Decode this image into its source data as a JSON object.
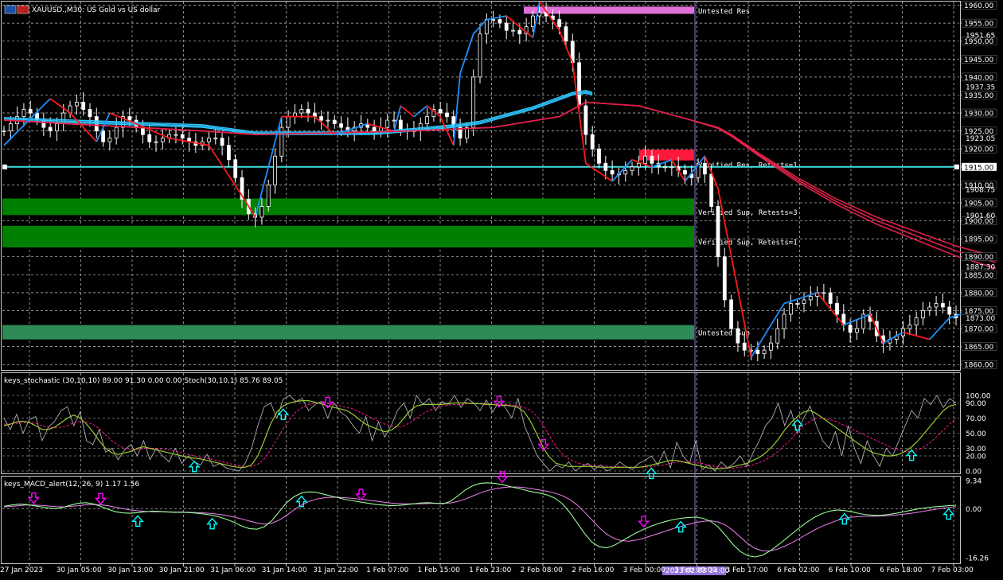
{
  "window": {
    "title": "XAUUSD.,M30:  US Gold vs US dollar"
  },
  "colors": {
    "background": "#000000",
    "grid": "#c8c8c8",
    "axis": "#c8c8c8",
    "bull": "#ffffff",
    "bear": "#ffffff",
    "zigzag_up": "#1e90ff",
    "zigzag_down": "#ff1a1a",
    "ma_fast": "#2ec8ff",
    "ma_slow": "#e0204a",
    "verified_sup": "#008000",
    "untested_sup": "#2e8b57",
    "verified_res": "#ff1a3c",
    "untested_res": "#e070d8",
    "hline": "#40e0e0",
    "stoch_main": "#9acd32",
    "stoch_signal": "#ff1493",
    "stoch_raw": "#c0c0c0",
    "macd_main": "#98fb98",
    "macd_signal": "#ee82ee",
    "arrow_up": "#00ffff",
    "arrow_down": "#ff00ff",
    "label_text": "#ffffff",
    "date_marker": "#9370db"
  },
  "chart_data": [
    {
      "type": "line",
      "title": "XAUUSD.,M30:  US Gold vs US dollar",
      "price_axis": {
        "ticks": [
          "1960.00",
          "1955.00",
          "1950.00",
          "1945.00",
          "1940.00",
          "1935.00",
          "1930.00",
          "1925.00",
          "1920.00",
          "1915.00",
          "1910.00",
          "1905.00",
          "1900.00",
          "1895.00",
          "1890.00",
          "1885.00",
          "1880.00",
          "1875.00",
          "1870.00",
          "1865.00",
          "1860.00"
        ],
        "extra_labels": [
          "1951.65",
          "1937.35",
          "1923.05",
          "1908.75",
          "1901.60",
          "1887.30",
          "1873.00"
        ],
        "highlight_label": "1915.00",
        "ylim": [
          1858.5,
          1961
        ]
      },
      "time_axis": {
        "labels": [
          "27 Jan 2023",
          "30 Jan 05:00",
          "30 Jan 13:00",
          "30 Jan 21:00",
          "31 Jan 06:00",
          "31 Jan 14:00",
          "31 Jan 22:00",
          "1 Feb 07:00",
          "1 Feb 15:00",
          "1 Feb 23:00",
          "2 Feb 08:00",
          "2 Feb 16:00",
          "3 Feb 00:00",
          "3 Feb 09:00",
          "3 Feb 17:00",
          "6 Feb 02:00",
          "6 Feb 10:00",
          "6 Feb 18:00",
          "7 Feb 03:00"
        ],
        "cursor_label": "2023.02.03 14:00"
      },
      "zones": [
        {
          "label": "Untested Res",
          "kind": "untested_res",
          "low": 1957.6,
          "high": 1959.6
        },
        {
          "label": "Verified Res, Retests=1",
          "kind": "verified_res",
          "low": 1916.8,
          "high": 1919.8
        },
        {
          "label": "Verified Sup, Retests=3",
          "kind": "verified_sup",
          "low": 1901.6,
          "high": 1906.2
        },
        {
          "label": "Verified Sup, Retests=1",
          "kind": "verified_sup",
          "low": 1892.6,
          "high": 1898.6
        },
        {
          "label": "Untested Sup",
          "kind": "untested_sup",
          "low": 1867.0,
          "high": 1871.0
        }
      ],
      "hline": 1915.0,
      "series": [
        {
          "role": "price_close",
          "values": [
            1925,
            1927,
            1929,
            1931,
            1930,
            1928,
            1926,
            1925,
            1927,
            1930,
            1932,
            1933,
            1931,
            1929,
            1925,
            1922,
            1923,
            1926,
            1929,
            1928,
            1926,
            1924,
            1922,
            1922,
            1923,
            1924,
            1924,
            1923,
            1922,
            1921,
            1922,
            1923,
            1923,
            1921,
            1917,
            1912,
            1906,
            1902,
            1901,
            1904,
            1910,
            1918,
            1926,
            1929,
            1930,
            1931,
            1930,
            1929,
            1928,
            1928,
            1927,
            1926,
            1925,
            1926,
            1927,
            1926,
            1925,
            1926,
            1928,
            1928,
            1925,
            1925,
            1925,
            1927,
            1929,
            1931,
            1930,
            1929,
            1926,
            1923,
            1926,
            1940,
            1952,
            1956,
            1956,
            1955,
            1953,
            1953,
            1952,
            1954,
            1957,
            1958,
            1957,
            1956,
            1954,
            1950,
            1944,
            1932,
            1924,
            1920,
            1916,
            1914,
            1913,
            1913,
            1914,
            1915,
            1916,
            1918,
            1916,
            1915,
            1915,
            1915,
            1914,
            1913,
            1912,
            1916,
            1913,
            1904,
            1890,
            1878,
            1870,
            1866,
            1864,
            1864,
            1863,
            1864,
            1866,
            1870,
            1874,
            1877,
            1877,
            1878,
            1879,
            1880,
            1880,
            1877,
            1874,
            1871,
            1869,
            1870,
            1874,
            1872,
            1868,
            1866,
            1867,
            1868,
            1870,
            1871,
            1873,
            1875,
            1876,
            1877,
            1876,
            1874,
            1873
          ]
        },
        {
          "role": "zigzag",
          "x": [
            0,
            7,
            10,
            14,
            16,
            20,
            25,
            31,
            36,
            38,
            42,
            47,
            50,
            55,
            59,
            60,
            62,
            64,
            66,
            68,
            69,
            71,
            73,
            76,
            80,
            81,
            84,
            86,
            88,
            92,
            95,
            98,
            101,
            103,
            106,
            108,
            113,
            118,
            123,
            127,
            131,
            133,
            136,
            140,
            143,
            148
          ],
          "values": [
            1921,
            1934,
            1930,
            1922,
            1930,
            1927,
            1923,
            1921,
            1907,
            1901,
            1929,
            1929,
            1924,
            1927,
            1925,
            1932,
            1929,
            1932,
            1929,
            1921,
            1941,
            1952,
            1956,
            1957,
            1951,
            1961,
            1953,
            1944,
            1916,
            1911,
            1917,
            1915,
            1917,
            1911,
            1918,
            1909,
            1862,
            1877,
            1880,
            1871,
            1874,
            1866,
            1869,
            1867,
            1873,
            1876
          ]
        },
        {
          "role": "ma_fast",
          "x": [
            0,
            30,
            38,
            44,
            50,
            56,
            62,
            68,
            72,
            76,
            80,
            83,
            86,
            88,
            89
          ],
          "values": [
            1928,
            1926,
            1924,
            1924,
            1924,
            1924,
            1925,
            1926,
            1927,
            1929,
            1931,
            1933,
            1935,
            1935.5,
            1935
          ]
        },
        {
          "role": "ma_slow",
          "x": [
            0,
            30,
            38,
            50,
            62,
            74,
            84,
            88,
            96,
            100,
            104,
            106,
            108,
            110,
            114,
            120,
            126,
            132,
            138,
            144,
            150
          ],
          "values": [
            1928,
            1925,
            1924,
            1924.5,
            1925,
            1926,
            1929,
            1933,
            1932,
            1930,
            1928,
            1927,
            1926,
            1924,
            1919,
            1912,
            1906,
            1901,
            1897,
            1893,
            1890
          ]
        }
      ]
    },
    {
      "type": "line",
      "title": "keys_stochastic (30,10,10) 89.00 91.30 0.00 0.00 Stoch(30,10,1) 85.76 89.05",
      "y_ticks": [
        "100.00",
        "90.00",
        "70.00",
        "50.00",
        "30.00",
        "20.00",
        "0.00"
      ],
      "ylim": [
        0,
        100
      ],
      "main": [
        60,
        62,
        65,
        66,
        64,
        60,
        55,
        55,
        58,
        64,
        70,
        74,
        70,
        62,
        52,
        40,
        30,
        24,
        22,
        24,
        26,
        30,
        32,
        30,
        28,
        26,
        24,
        22,
        20,
        18,
        17,
        16,
        14,
        12,
        10,
        8,
        6,
        5,
        5,
        8,
        20,
        40,
        62,
        78,
        86,
        90,
        92,
        93,
        93,
        91,
        89,
        86,
        84,
        82,
        80,
        75,
        68,
        62,
        58,
        55,
        52,
        54,
        60,
        70,
        80,
        86,
        88,
        88,
        88,
        88,
        89,
        90,
        90,
        90,
        89,
        89,
        88,
        88,
        87,
        87,
        86,
        84,
        78,
        65,
        48,
        30,
        18,
        10,
        8,
        6,
        6,
        6,
        6,
        6,
        5,
        5,
        5,
        5,
        5,
        5,
        5,
        6,
        8,
        10,
        12,
        14,
        14,
        12,
        10,
        8,
        6,
        4,
        3,
        3,
        4,
        6,
        8,
        10,
        14,
        18,
        24,
        32,
        42,
        54,
        64,
        72,
        78,
        80,
        76,
        70,
        64,
        58,
        52,
        46,
        40,
        34,
        28,
        24,
        22,
        20,
        20,
        22,
        26,
        32,
        40,
        50,
        60,
        70,
        80,
        86,
        88
      ],
      "signal": [
        62,
        62,
        63,
        64,
        64,
        63,
        60,
        58,
        57,
        58,
        60,
        64,
        66,
        65,
        62,
        56,
        48,
        40,
        34,
        30,
        28,
        28,
        30,
        30,
        30,
        29,
        28,
        26,
        24,
        22,
        20,
        18,
        17,
        15,
        13,
        11,
        9,
        7,
        6,
        6,
        9,
        16,
        28,
        42,
        56,
        68,
        78,
        84,
        88,
        90,
        90,
        89,
        88,
        86,
        84,
        82,
        78,
        74,
        70,
        66,
        62,
        60,
        58,
        60,
        64,
        70,
        76,
        80,
        84,
        86,
        87,
        88,
        88,
        89,
        89,
        89,
        89,
        88,
        88,
        88,
        87,
        86,
        84,
        80,
        72,
        60,
        46,
        32,
        22,
        16,
        12,
        9,
        8,
        7,
        7,
        6,
        6,
        6,
        5,
        5,
        5,
        5,
        6,
        7,
        8,
        10,
        12,
        12,
        12,
        11,
        10,
        8,
        6,
        5,
        4,
        4,
        5,
        6,
        8,
        11,
        15,
        20,
        26,
        34,
        42,
        52,
        60,
        66,
        70,
        70,
        68,
        66,
        62,
        58,
        54,
        50,
        46,
        42,
        38,
        34,
        30,
        28,
        26,
        26,
        28,
        32,
        38,
        46,
        54,
        62,
        70
      ],
      "raw": [
        70,
        55,
        75,
        50,
        68,
        72,
        40,
        58,
        66,
        80,
        85,
        60,
        78,
        40,
        35,
        55,
        25,
        30,
        15,
        28,
        35,
        20,
        40,
        15,
        30,
        20,
        12,
        30,
        10,
        20,
        12,
        8,
        22,
        6,
        10,
        4,
        2,
        0,
        10,
        30,
        60,
        85,
        90,
        70,
        95,
        100,
        92,
        96,
        80,
        88,
        92,
        70,
        90,
        78,
        72,
        60,
        50,
        72,
        40,
        65,
        45,
        60,
        80,
        90,
        70,
        100,
        88,
        96,
        80,
        92,
        88,
        100,
        84,
        96,
        90,
        80,
        94,
        78,
        92,
        84,
        70,
        96,
        60,
        40,
        20,
        10,
        0,
        8,
        4,
        12,
        0,
        6,
        10,
        2,
        8,
        0,
        4,
        12,
        6,
        2,
        10,
        14,
        20,
        8,
        26,
        4,
        38,
        20,
        10,
        40,
        2,
        8,
        0,
        12,
        4,
        10,
        20,
        6,
        24,
        40,
        60,
        70,
        90,
        60,
        80,
        50,
        70,
        86,
        60,
        40,
        30,
        52,
        20,
        60,
        30,
        10,
        40,
        20,
        6,
        30,
        20,
        40,
        60,
        80,
        70,
        96,
        88,
        100,
        84,
        96,
        90
      ],
      "signals_up": [
        30,
        44,
        102,
        125,
        143
      ],
      "signals_down": [
        51,
        78,
        85
      ]
    },
    {
      "type": "line",
      "title": "keys_MACD_alert(12, 26, 9) 1.17 1.56",
      "y_ticks": [
        "9.34",
        "0.00",
        "-16.26"
      ],
      "ylim": [
        -16.26,
        9.34
      ],
      "main": [
        0.8,
        1.2,
        1.5,
        1.4,
        1.0,
        0.6,
        0.2,
        0.0,
        0.5,
        1.2,
        1.8,
        2.0,
        1.6,
        0.8,
        -0.2,
        -1.0,
        -1.4,
        -1.5,
        -1.3,
        -1.0,
        -0.8,
        -0.9,
        -1.1,
        -1.2,
        -1.2,
        -1.3,
        -1.5,
        -1.8,
        -2.2,
        -2.8,
        -3.6,
        -4.6,
        -5.8,
        -6.6,
        -6.8,
        -6.0,
        -4.0,
        -1.0,
        2.0,
        4.0,
        5.2,
        5.6,
        5.4,
        4.8,
        4.2,
        3.6,
        3.0,
        2.6,
        2.2,
        1.8,
        1.4,
        1.2,
        1.0,
        1.1,
        1.3,
        1.6,
        1.9,
        2.0,
        1.8,
        1.6,
        2.4,
        4.2,
        6.2,
        7.6,
        8.4,
        8.6,
        8.4,
        8.0,
        7.4,
        6.8,
        6.2,
        5.6,
        5.2,
        4.6,
        3.6,
        1.8,
        -1.0,
        -4.5,
        -8.0,
        -11.0,
        -12.6,
        -13.0,
        -12.2,
        -10.8,
        -9.4,
        -8.0,
        -6.8,
        -5.8,
        -4.9,
        -4.2,
        -3.6,
        -3.2,
        -2.9,
        -2.8,
        -3.2,
        -4.2,
        -6.0,
        -8.8,
        -11.8,
        -14.2,
        -15.6,
        -16.0,
        -15.4,
        -14.0,
        -12.2,
        -10.2,
        -8.2,
        -6.2,
        -4.4,
        -2.8,
        -1.6,
        -0.8,
        -0.4,
        -0.6,
        -1.0,
        -1.6,
        -2.0,
        -2.2,
        -2.2,
        -1.9,
        -1.5,
        -1.0,
        -0.5,
        0.0,
        0.3,
        0.6,
        0.8,
        1.0,
        1.17
      ],
      "signal": [
        0.6,
        0.8,
        1.0,
        1.2,
        1.2,
        1.1,
        0.9,
        0.7,
        0.6,
        0.8,
        1.0,
        1.3,
        1.4,
        1.3,
        1.0,
        0.5,
        0.0,
        -0.4,
        -0.7,
        -0.9,
        -1.0,
        -1.0,
        -1.0,
        -1.1,
        -1.1,
        -1.2,
        -1.3,
        -1.4,
        -1.6,
        -1.9,
        -2.3,
        -2.8,
        -3.4,
        -4.1,
        -4.7,
        -5.1,
        -4.8,
        -3.8,
        -2.2,
        -0.4,
        1.2,
        2.4,
        3.2,
        3.6,
        3.8,
        3.8,
        3.6,
        3.4,
        3.1,
        2.8,
        2.5,
        2.2,
        1.9,
        1.7,
        1.6,
        1.6,
        1.6,
        1.7,
        1.8,
        1.8,
        1.9,
        2.4,
        3.2,
        4.2,
        5.2,
        6.0,
        6.6,
        7.0,
        7.2,
        7.2,
        7.0,
        6.6,
        6.2,
        5.8,
        5.2,
        4.4,
        3.2,
        1.4,
        -1.0,
        -3.6,
        -6.2,
        -8.4,
        -9.8,
        -10.6,
        -10.8,
        -10.4,
        -9.8,
        -9.0,
        -8.2,
        -7.4,
        -6.6,
        -5.9,
        -5.2,
        -4.6,
        -4.2,
        -4.0,
        -4.4,
        -5.4,
        -7.2,
        -9.4,
        -11.6,
        -13.2,
        -14.0,
        -14.0,
        -13.4,
        -12.4,
        -11.2,
        -9.8,
        -8.4,
        -7.0,
        -5.8,
        -4.8,
        -3.9,
        -3.2,
        -2.8,
        -2.6,
        -2.5,
        -2.5,
        -2.4,
        -2.3,
        -2.1,
        -1.8,
        -1.5,
        -1.1,
        -0.7,
        -0.3,
        0.1,
        0.4,
        0.7
      ],
      "signals_up": [
        18,
        28,
        40,
        91,
        113,
        127,
        135
      ],
      "signals_down": [
        4,
        13,
        48,
        67,
        86
      ]
    }
  ]
}
